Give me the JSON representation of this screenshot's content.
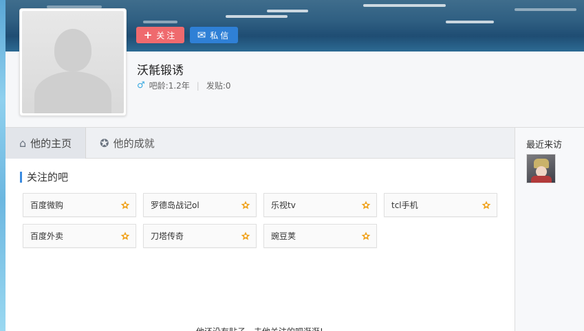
{
  "profile": {
    "username": "沃毻锻诱",
    "age_label": "吧龄:1.2年",
    "posts_label": "发贴:0",
    "gender_icon": "male-icon"
  },
  "actions": {
    "follow_label": "关注",
    "follow_icon": "+",
    "message_label": "私信",
    "message_icon": "✉"
  },
  "tabs": [
    {
      "label": "他的主页",
      "icon": "home-icon"
    },
    {
      "label": "他的成就",
      "icon": "achievement-icon"
    }
  ],
  "followed_bars": {
    "title": "关注的吧",
    "items": [
      {
        "name": "百度微购"
      },
      {
        "name": "罗德岛战记ol"
      },
      {
        "name": "乐视tv"
      },
      {
        "name": "tcl手机"
      },
      {
        "name": "百度外卖"
      },
      {
        "name": "刀塔传奇"
      },
      {
        "name": "豌豆荚"
      }
    ]
  },
  "sidebar": {
    "recent_visitors_title": "最近来访"
  },
  "bottom_note": "他还没有贴子，去他关注的吧逛逛!",
  "colors": {
    "follow": "#ef6a6e",
    "message": "#2f80d6",
    "accent": "#3b8be0",
    "star": "#f0a31f"
  }
}
